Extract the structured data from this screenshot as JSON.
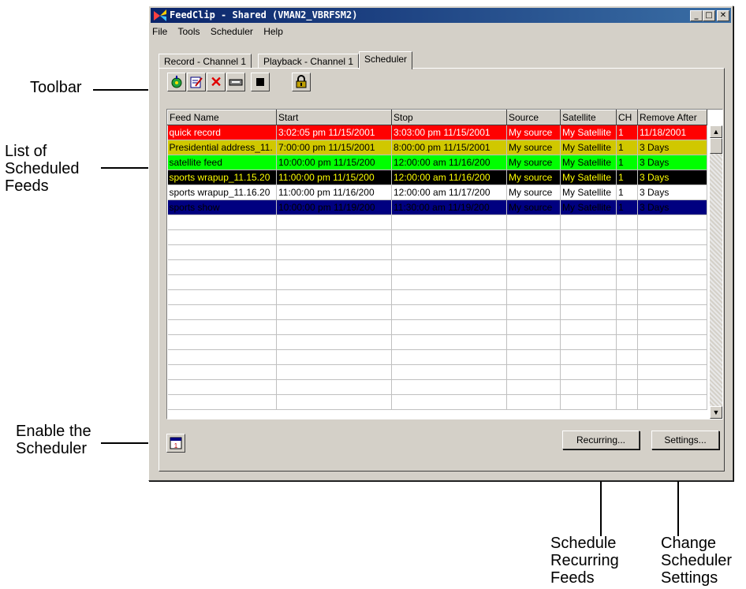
{
  "window": {
    "title": "FeedClip - Shared (VMAN2_VBRFSM2)"
  },
  "menu": [
    "File",
    "Tools",
    "Scheduler",
    "Help"
  ],
  "tabs": [
    "Record - Channel 1",
    "Playback - Channel 1",
    "Scheduler"
  ],
  "toolbar_icons": [
    "new-feed-icon",
    "edit-feed-icon",
    "delete-feed-icon",
    "tape-icon",
    "stop-icon",
    "lock-icon"
  ],
  "columns": [
    "Feed Name",
    "Start",
    "Stop",
    "Source",
    "Satellite",
    "CH",
    "Remove After"
  ],
  "rows": [
    {
      "cells": [
        "quick record",
        "3:02:05 pm  11/15/2001",
        "3:03:00 pm  11/15/2001",
        "My source",
        "My Satellite",
        "1",
        "11/18/2001"
      ],
      "bg": "#ff0000",
      "fg": "#ffffff"
    },
    {
      "cells": [
        "Presidential address_11.",
        "7:00:00 pm  11/15/2001",
        "8:00:00 pm  11/15/2001",
        "My source",
        "My Satellite",
        "1",
        "3 Days"
      ],
      "bg": "#d0c800",
      "fg": "#000000"
    },
    {
      "cells": [
        "satellite feed",
        "10:00:00 pm  11/15/200",
        "12:00:00 am  11/16/200",
        "My source",
        "My Satellite",
        "1",
        "3 Days"
      ],
      "bg": "#00ff00",
      "fg": "#000000"
    },
    {
      "cells": [
        "sports wrapup_11.15.20",
        "11:00:00 pm  11/15/200",
        "12:00:00 am  11/16/200",
        "My source",
        "My Satellite",
        "1",
        "3 Days"
      ],
      "bg": "#000000",
      "fg": "#ffff00"
    },
    {
      "cells": [
        "sports wrapup_11.16.20",
        "11:00:00 pm  11/16/200",
        "12:00:00 am  11/17/200",
        "My source",
        "My Satellite",
        "1",
        "3 Days"
      ],
      "bg": "#ffffff",
      "fg": "#000000"
    },
    {
      "cells": [
        "sports show",
        "10:00:00 pm  11/19/200",
        "11:30:00 am  11/19/200",
        "My source",
        "My Satellite",
        "1",
        "3 Days"
      ],
      "bg": "#000080",
      "fg": "#000000"
    }
  ],
  "empty_rows": 13,
  "buttons": {
    "recurring": "Recurring...",
    "settings": "Settings..."
  },
  "scheduler_icon": "calendar-icon",
  "callouts": {
    "toolbar": "Toolbar",
    "list": [
      "List of",
      "Scheduled",
      "Feeds"
    ],
    "enable": [
      "Enable the",
      "Scheduler"
    ],
    "recurring": [
      "Schedule",
      "Recurring",
      "Feeds"
    ],
    "settings": [
      "Change",
      "Scheduler",
      "Settings"
    ]
  }
}
